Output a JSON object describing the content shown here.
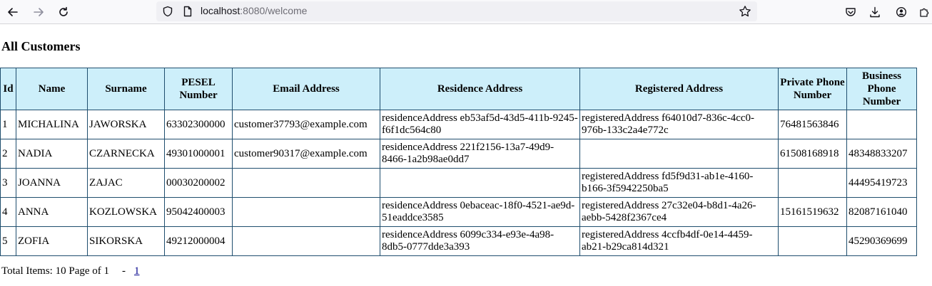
{
  "browser": {
    "url_host": "localhost",
    "url_rest": ":8080/welcome"
  },
  "page": {
    "title": "All Customers",
    "columns": [
      "Id",
      "Name",
      "Surname",
      "PESEL Number",
      "Email Address",
      "Residence Address",
      "Registered Address",
      "Private Phone Number",
      "Business Phone Number"
    ],
    "rows": [
      [
        "1",
        "MICHALINA",
        "JAWORSKA",
        "63302300000",
        "customer37793@example.com",
        "residenceAddress eb53af5d-43d5-411b-9245-f6f1dc564c80",
        "registeredAddress f64010d7-836c-4cc0-976b-133c2a4e772c",
        "76481563846",
        ""
      ],
      [
        "2",
        "NADIA",
        "CZARNECKA",
        "49301000001",
        "customer90317@example.com",
        "residenceAddress 221f2156-13a7-49d9-8466-1a2b98ae0dd7",
        "",
        "61508168918",
        "48348833207"
      ],
      [
        "3",
        "JOANNA",
        "ZAJAC",
        "00030200002",
        "",
        "",
        "registeredAddress fd5f9d31-ab1e-4160-b166-3f5942250ba5",
        "",
        "44495419723"
      ],
      [
        "4",
        "ANNA",
        "KOZLOWSKA",
        "95042400003",
        "",
        "residenceAddress 0ebaceac-18f0-4521-ae9d-51eaddce3585",
        "registeredAddress 27c32e04-b8d1-4a26-aebb-5428f2367ce4",
        "15161519632",
        "82087161040"
      ],
      [
        "5",
        "ZOFIA",
        "SIKORSKA",
        "49212000004",
        "",
        "residenceAddress 6099c334-e93e-4a98-8db5-0777dde3a393",
        "registeredAddress 4ccfb4df-0e14-4459-ab21-b29ca814d321",
        "",
        "45290369699"
      ]
    ],
    "footer": {
      "summary": "Total Items: 10 Page of 1",
      "separator": "-",
      "page_link": "1"
    }
  }
}
